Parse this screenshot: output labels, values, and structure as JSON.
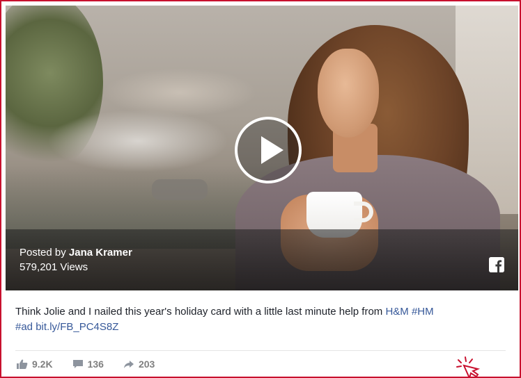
{
  "video": {
    "posted_prefix": "Posted by ",
    "author": "Jana Kramer",
    "views": "579,201 Views",
    "play_icon": "play-icon",
    "share_icon": "facebook-icon"
  },
  "post": {
    "text": "Think Jolie and I nailed this year's holiday card with a little last minute help from ",
    "mention": "H&M",
    "hashtag1": "#HM",
    "hashtag2": "#ad",
    "link": "bit.ly/FB_PC4S8Z"
  },
  "reactions": {
    "likes": "9.2K",
    "comments": "136",
    "shares": "203"
  },
  "colors": {
    "border": "#c8102e",
    "link": "#365899",
    "text": "#1d2129",
    "muted": "#7f7f7f"
  }
}
